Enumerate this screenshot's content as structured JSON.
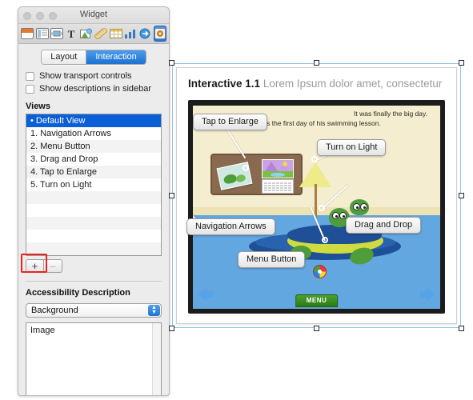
{
  "window": {
    "title": "Widget",
    "traffic_lights": [
      "close-button",
      "minimize-button",
      "zoom-button"
    ],
    "toolbar_icons": [
      {
        "name": "document-icon",
        "label": "Document"
      },
      {
        "name": "layout-icon",
        "label": "Layout"
      },
      {
        "name": "arrange-icon",
        "label": "Arrange"
      },
      {
        "name": "text-icon",
        "label": "Text"
      },
      {
        "name": "graphic-icon",
        "label": "Graphic"
      },
      {
        "name": "metrics-icon",
        "label": "Metrics"
      },
      {
        "name": "table-icon",
        "label": "Table"
      },
      {
        "name": "chart-icon",
        "label": "Chart"
      },
      {
        "name": "link-icon",
        "label": "Link"
      },
      {
        "name": "widget-icon",
        "label": "Widget"
      }
    ],
    "active_toolbar_icon": "widget-icon"
  },
  "tabs": {
    "layout": "Layout",
    "interaction": "Interaction",
    "selected": "Interaction"
  },
  "checkboxes": [
    {
      "label": "Show transport controls",
      "checked": false
    },
    {
      "label": "Show descriptions in sidebar",
      "checked": false
    }
  ],
  "views": {
    "heading": "Views",
    "items": [
      {
        "label": "• Default View",
        "selected": true
      },
      {
        "label": "1. Navigation Arrows",
        "selected": false
      },
      {
        "label": "2. Menu Button",
        "selected": false
      },
      {
        "label": "3. Drag and Drop",
        "selected": false
      },
      {
        "label": "4. Tap to Enlarge",
        "selected": false
      },
      {
        "label": "5. Turn on Light",
        "selected": false
      }
    ],
    "empty_row_count": 6,
    "add_button": "+",
    "remove_button": "–",
    "highlight_color": "#ef2020",
    "selection_color": "#0b5fd6"
  },
  "accessibility": {
    "heading": "Accessibility Description",
    "popup_value": "Background",
    "popup_options": [
      "Background"
    ],
    "description_text": "Image"
  },
  "canvas": {
    "doc_title_bold": "Interactive 1.1",
    "doc_title_rest": "Lorem Ipsum dolor amet, consectetur",
    "story_line_1": "It was finally the big day.",
    "story_line_2": "It was the first day of his swimming lesson.",
    "menu_button_label": "MENU",
    "callouts": [
      {
        "name": "callout-tap-to-enlarge",
        "label": "Tap to Enlarge"
      },
      {
        "name": "callout-turn-on-light",
        "label": "Turn on Light"
      },
      {
        "name": "callout-navigation-arrows",
        "label": "Navigation Arrows"
      },
      {
        "name": "callout-drag-and-drop",
        "label": "Drag and Drop"
      },
      {
        "name": "callout-menu-button",
        "label": "Menu Button"
      }
    ],
    "selection_handle_count": 8
  }
}
